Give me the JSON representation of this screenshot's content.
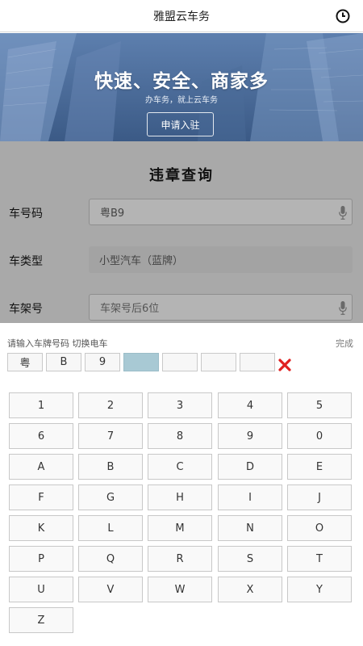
{
  "header": {
    "title": "雅盟云车务",
    "right_icon": "clock-icon"
  },
  "banner": {
    "headline": "快速、安全、商家多",
    "subtitle": "办车务，就上云车务",
    "apply_button": "申请入驻"
  },
  "form": {
    "title": "违章查询",
    "plate": {
      "label": "车号码",
      "value": "粤B9"
    },
    "vehicle_type": {
      "label": "车类型",
      "value": "小型汽车（蓝牌）"
    },
    "frame": {
      "label": "车架号",
      "placeholder": "车架号后6位"
    }
  },
  "keyboard": {
    "hint": "请输入车牌号码 切换电车",
    "done": "完成",
    "slots": [
      "粤",
      "B",
      "9",
      "",
      "",
      "",
      ""
    ],
    "active_slot": 3,
    "delete_icon": "close-icon",
    "delete_color": "#e02020",
    "keys": [
      "1",
      "2",
      "3",
      "4",
      "5",
      "6",
      "7",
      "8",
      "9",
      "0",
      "A",
      "B",
      "C",
      "D",
      "E",
      "F",
      "G",
      "H",
      "I",
      "J",
      "K",
      "L",
      "M",
      "N",
      "O",
      "P",
      "Q",
      "R",
      "S",
      "T",
      "U",
      "V",
      "W",
      "X",
      "Y",
      "Z"
    ]
  }
}
